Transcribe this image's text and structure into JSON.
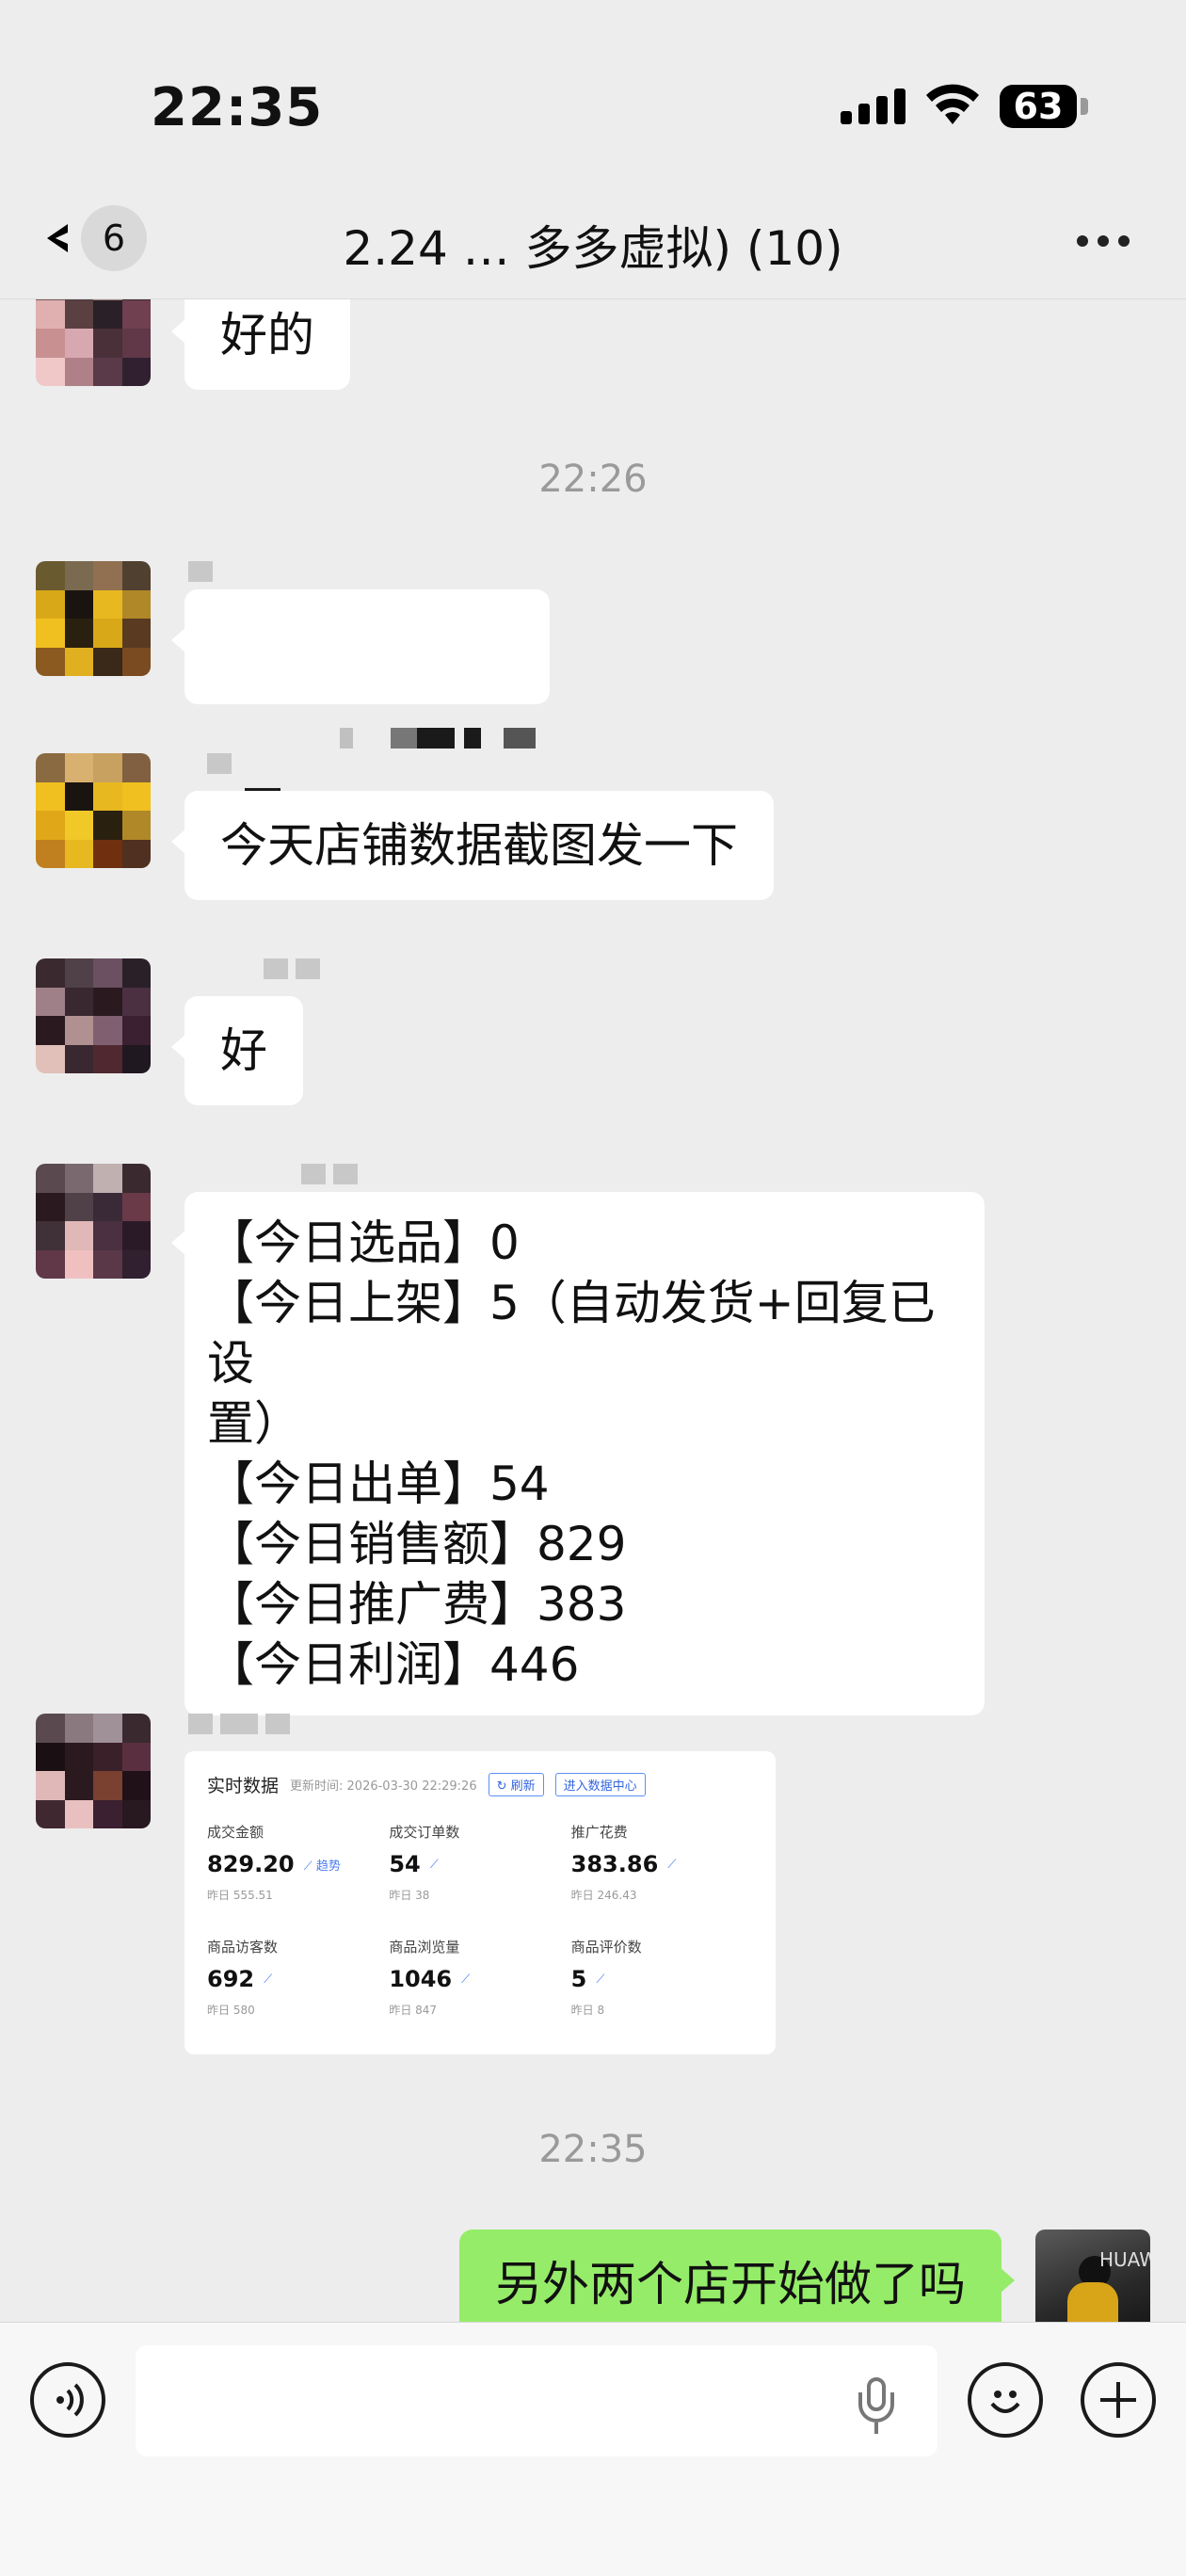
{
  "status_bar": {
    "time": "22:35",
    "battery": "63"
  },
  "nav": {
    "unread_count": "6",
    "title": "2.24 … 多多虚拟) (10)"
  },
  "messages": [
    {
      "type": "text",
      "text": "好的"
    },
    {
      "type": "timestamp",
      "text": "22:26"
    },
    {
      "type": "text",
      "text": ""
    },
    {
      "type": "text",
      "text": "今天店铺数据截图发一下"
    },
    {
      "type": "text",
      "text": "好"
    },
    {
      "type": "text",
      "text": "【今日选品】0\n【今日上架】5（自动发货+回复已设\n置）\n【今日出单】54\n【今日销售额】829\n【今日推广费】383\n【今日利润】446"
    },
    {
      "type": "image"
    },
    {
      "type": "timestamp",
      "text": "22:35"
    },
    {
      "type": "text",
      "text": "另外两个店开始做了吗",
      "mine": true
    }
  ],
  "data_card": {
    "title": "实时数据",
    "updated": "更新时间: 2026-03-30 22:29:26",
    "refresh_label": "刷新",
    "datacenter_label": "进入数据中心",
    "trend_label": "趋势",
    "metrics": [
      {
        "label": "成交金额",
        "value": "829.20",
        "yesterday": "昨日 555.51"
      },
      {
        "label": "成交订单数",
        "value": "54",
        "yesterday": "昨日 38"
      },
      {
        "label": "推广花费",
        "value": "383.86",
        "yesterday": "昨日 246.43"
      },
      {
        "label": "商品访客数",
        "value": "692",
        "yesterday": "昨日 580"
      },
      {
        "label": "商品浏览量",
        "value": "1046",
        "yesterday": "昨日 847"
      },
      {
        "label": "商品评价数",
        "value": "5",
        "yesterday": "昨日 8"
      }
    ]
  },
  "self_avatar": {
    "text": "HUAWE"
  },
  "input": {
    "value": "",
    "placeholder": ""
  },
  "colors": {
    "background": "#ededed",
    "my_bubble": "#95ec69",
    "their_bubble": "#ffffff",
    "timestamp": "#9a9a9a"
  }
}
